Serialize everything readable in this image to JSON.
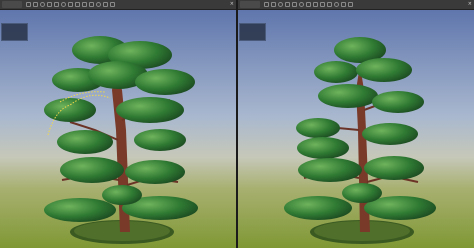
{
  "viewports": [
    {
      "tab_label": "",
      "stats_title": "",
      "stats": []
    },
    {
      "tab_label": "",
      "stats_title": "",
      "stats": []
    }
  ],
  "toolbar": {
    "icons": [
      "select-icon",
      "move-icon",
      "rotate-icon",
      "scale-icon",
      "camera-icon",
      "light-icon",
      "grid-icon",
      "render-icon",
      "shading-icon",
      "view-icon",
      "options-icon",
      "settings-icon",
      "more-icon"
    ],
    "close_glyph": "×"
  },
  "colors": {
    "sky_top": "#6e84b8",
    "sky_mid": "#aab7cf",
    "ground": "#8ea244",
    "foliage": "#2f7a33",
    "foliage_light": "#56a24c",
    "trunk": "#7a3a2a",
    "selection_curve": "#f2d84a"
  }
}
